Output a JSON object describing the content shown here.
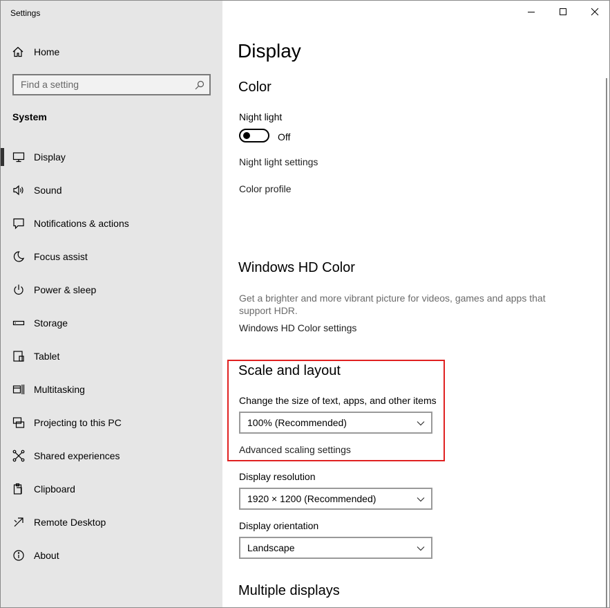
{
  "window": {
    "title": "Settings"
  },
  "sidebar": {
    "home_label": "Home",
    "search_placeholder": "Find a setting",
    "section_label": "System",
    "items": [
      {
        "label": "Display",
        "icon": "monitor-icon",
        "active": true
      },
      {
        "label": "Sound",
        "icon": "speaker-icon"
      },
      {
        "label": "Notifications & actions",
        "icon": "notification-icon"
      },
      {
        "label": "Focus assist",
        "icon": "moon-icon"
      },
      {
        "label": "Power & sleep",
        "icon": "power-icon"
      },
      {
        "label": "Storage",
        "icon": "storage-icon"
      },
      {
        "label": "Tablet",
        "icon": "tablet-icon"
      },
      {
        "label": "Multitasking",
        "icon": "multitasking-icon"
      },
      {
        "label": "Projecting to this PC",
        "icon": "projecting-icon"
      },
      {
        "label": "Shared experiences",
        "icon": "shared-icon"
      },
      {
        "label": "Clipboard",
        "icon": "clipboard-icon"
      },
      {
        "label": "Remote Desktop",
        "icon": "remote-desktop-icon"
      },
      {
        "label": "About",
        "icon": "info-icon"
      }
    ]
  },
  "main": {
    "page_title": "Display",
    "color": {
      "heading": "Color",
      "night_light_label": "Night light",
      "night_light_state": "Off",
      "night_light_settings_link": "Night light settings",
      "color_profile_label": "Color profile"
    },
    "hd_color": {
      "heading": "Windows HD Color",
      "description": "Get a brighter and more vibrant picture for videos, games and apps that support HDR.",
      "settings_link": "Windows HD Color settings"
    },
    "scale_layout": {
      "heading": "Scale and layout",
      "size_label": "Change the size of text, apps, and other items",
      "size_value": "100% (Recommended)",
      "advanced_link": "Advanced scaling settings",
      "resolution_label": "Display resolution",
      "resolution_value": "1920 × 1200 (Recommended)",
      "orientation_label": "Display orientation",
      "orientation_value": "Landscape"
    },
    "multiple_displays": {
      "heading": "Multiple displays"
    }
  },
  "colors": {
    "sidebar_bg": "#e6e6e6",
    "highlight_border": "#e02020",
    "description_text": "#6b6b6b"
  }
}
